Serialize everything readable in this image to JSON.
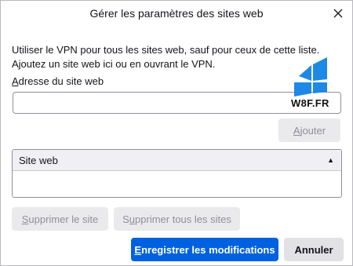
{
  "dialog": {
    "title": "Gérer les paramètres des sites web",
    "description": "Utiliser le VPN pour tous les sites web, sauf pour ceux de cette liste. Ajoutez un site web ici ou en ouvrant le VPN.",
    "field_label_accesskey": "A",
    "field_label_rest": "dresse du site web",
    "url_input_value": "",
    "add_button": {
      "accesskey": "A",
      "rest": "jouter"
    },
    "table": {
      "column_header": "Site web",
      "sort_indicator": "ascending",
      "rows": []
    },
    "remove_site_button": {
      "accesskey": "S",
      "rest": "upprimer le site"
    },
    "remove_all_button": {
      "prefix": "S",
      "accesskey": "u",
      "rest": "pprimer tous les sites"
    },
    "save_button": {
      "accesskey": "E",
      "rest": "nregistrer les modifications"
    },
    "cancel_button": "Annuler"
  },
  "watermark": {
    "text": "W8F.FR",
    "logo": "windows-logo"
  },
  "colors": {
    "primary": "#0061e0",
    "disabled_bg": "#eaeaed",
    "secondary_bg": "#e1e1e6",
    "watermark_blue": "#1e88e5"
  }
}
